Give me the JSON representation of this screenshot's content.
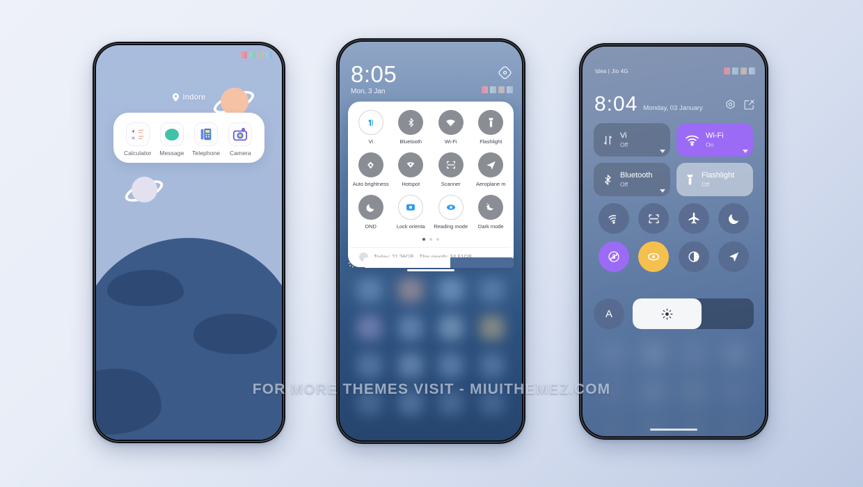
{
  "scene": {
    "watermark": "FOR MORE THEMES VISIT - MIUITHEMEZ.COM",
    "background_top": "#eef1f9",
    "background_bottom": "#bcc9e2"
  },
  "phone1": {
    "name": "home-screen",
    "location_widget": {
      "icon": "location-pin-icon",
      "label": "Indore"
    },
    "dock": {
      "apps": [
        {
          "label": "Calculator",
          "icon": "calculator-icon"
        },
        {
          "label": "Message",
          "icon": "message-icon"
        },
        {
          "label": "Telephone",
          "icon": "telephone-icon"
        },
        {
          "label": "Camera",
          "icon": "camera-icon"
        }
      ]
    },
    "decorations": [
      {
        "name": "saturn-peach",
        "color": "#f6c2a5"
      },
      {
        "name": "saturn-lavender",
        "color": "#e3e1f0"
      }
    ],
    "status_icons": [
      "signal-icon",
      "sim-icon",
      "wifi-icon",
      "battery-icon"
    ]
  },
  "phone2": {
    "name": "miui-control-center",
    "time": "8:05",
    "date": "Mon, 3 Jan",
    "top_icon": "settings-diamond-icon",
    "status_icons": [
      "signal-icon",
      "sim-icon",
      "wifi-icon",
      "battery-icon"
    ],
    "toggles": [
      {
        "label": "Vi",
        "icon": "sim-vi-icon",
        "active": true
      },
      {
        "label": "Bluetooth",
        "icon": "bluetooth-icon",
        "active": false
      },
      {
        "label": "Wi-Fi",
        "icon": "wifi-icon",
        "active": false
      },
      {
        "label": "Flashlight",
        "icon": "flashlight-icon",
        "active": false
      },
      {
        "label": "Auto brightness",
        "icon": "auto-brightness-icon",
        "active": false
      },
      {
        "label": "Hotspot",
        "icon": "hotspot-icon",
        "active": false
      },
      {
        "label": "Scanner",
        "icon": "scanner-icon",
        "active": false
      },
      {
        "label": "Aeroplane m",
        "icon": "aeroplane-icon",
        "active": false
      },
      {
        "label": "DND",
        "icon": "moon-icon",
        "active": false
      },
      {
        "label": "Lock orienta",
        "icon": "rotation-lock-icon",
        "active": true
      },
      {
        "label": "Reading mode",
        "icon": "reading-mode-icon",
        "active": true
      },
      {
        "label": "Dark mode",
        "icon": "dark-mode-icon",
        "active": false
      }
    ],
    "pages": {
      "count": 3,
      "current": 1
    },
    "data_usage": {
      "icon": "data-usage-icon",
      "today": "Today: 21.36GB",
      "month": "This month: 34.51GB"
    },
    "brightness": {
      "icon": "brightness-icon",
      "value": 58
    }
  },
  "phone3": {
    "name": "ios-control-center",
    "carrier": "Idea | Jio 4G",
    "time": "8:04",
    "date": "Monday, 03 January",
    "header_icons": [
      "settings-gear-icon",
      "edit-icon"
    ],
    "status_icons": [
      "signal-icon",
      "sim-icon",
      "wifi-icon",
      "battery-icon"
    ],
    "big_tiles": [
      {
        "name": "Vi",
        "state": "Off",
        "icon": "mobile-data-icon",
        "accent": "#5f6f89",
        "on": false
      },
      {
        "name": "Wi-Fi",
        "state": "On",
        "icon": "wifi-icon",
        "accent": "#9b6bf5",
        "on": true
      },
      {
        "name": "Bluetooth",
        "state": "Off",
        "icon": "bluetooth-icon",
        "accent": "#5f6f89",
        "on": false
      },
      {
        "name": "Flashlight",
        "state": "Off",
        "icon": "flashlight-icon",
        "accent": "#c3ccd9",
        "on": false
      }
    ],
    "circle_toggles": [
      {
        "name": "hotspot",
        "icon": "hotspot-icon",
        "color": "#56678a"
      },
      {
        "name": "scanner",
        "icon": "scanner-icon",
        "color": "#56678a"
      },
      {
        "name": "aeroplane",
        "icon": "aeroplane-icon",
        "color": "#56678a"
      },
      {
        "name": "dnd",
        "icon": "moon-icon",
        "color": "#56678a"
      },
      {
        "name": "rotation-lock",
        "icon": "rotation-lock-icon",
        "color": "#9b6bf5"
      },
      {
        "name": "reading-mode",
        "icon": "eye-icon",
        "color": "#f5c04e"
      },
      {
        "name": "dark-mode",
        "icon": "contrast-icon",
        "color": "#56678a"
      },
      {
        "name": "location",
        "icon": "location-arrow-icon",
        "color": "#56678a"
      }
    ],
    "auto_brightness": {
      "label": "A",
      "icon": "auto-brightness-letter-icon"
    },
    "brightness": {
      "icon": "brightness-icon",
      "value": 57
    }
  }
}
